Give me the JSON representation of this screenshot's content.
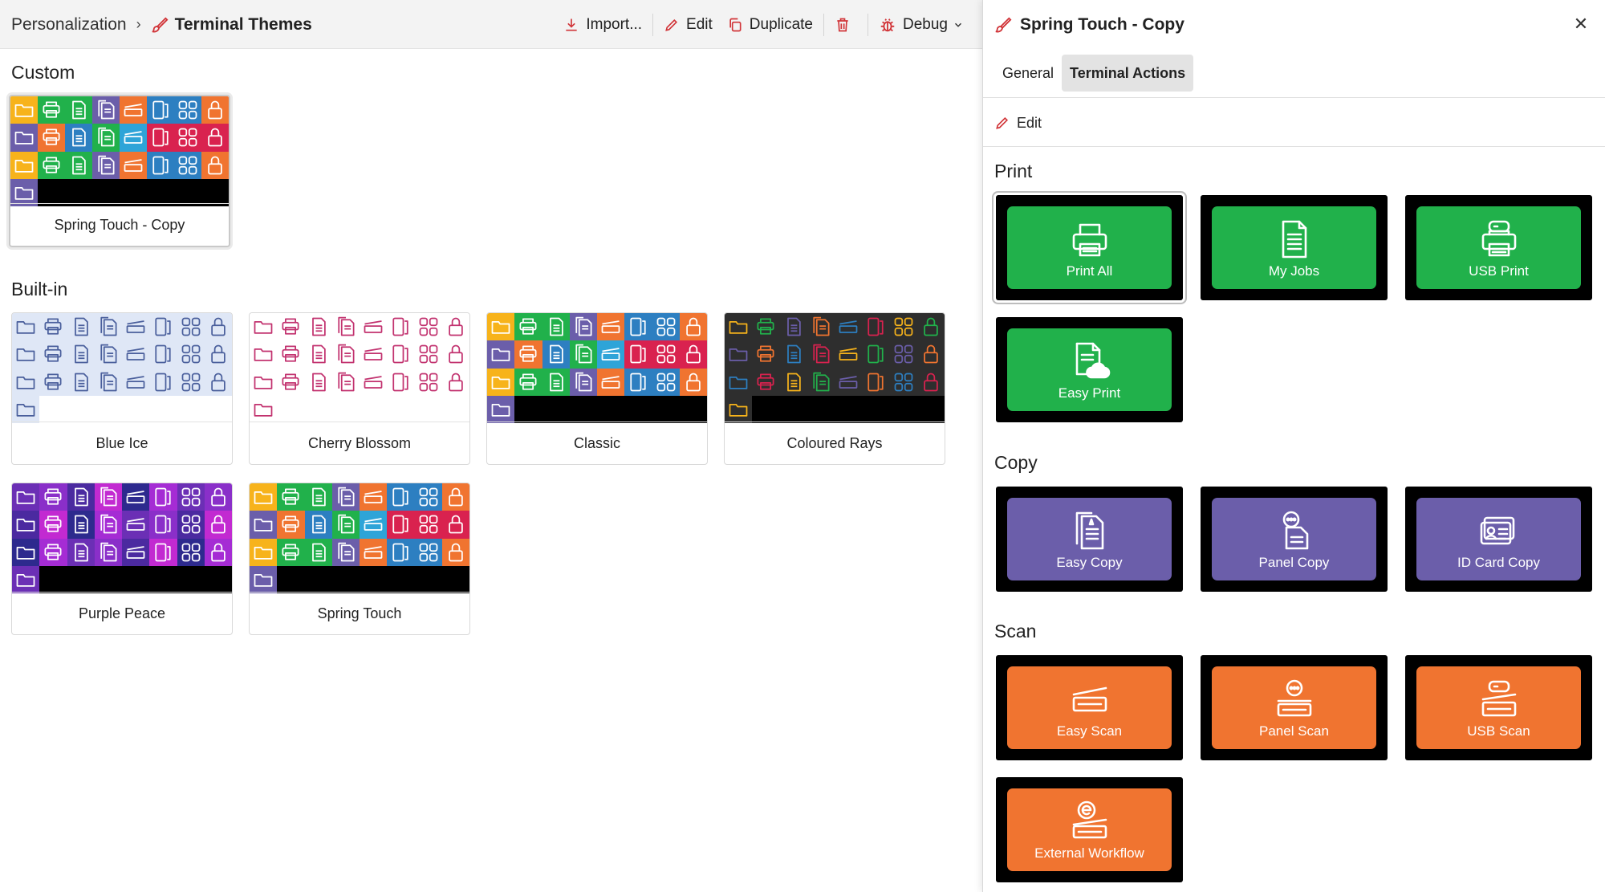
{
  "breadcrumb": {
    "parent": "Personalization",
    "current": "Terminal Themes"
  },
  "toolbar": {
    "import": "Import...",
    "edit": "Edit",
    "duplicate": "Duplicate",
    "debug": "Debug"
  },
  "sections": {
    "custom": "Custom",
    "builtin": "Built-in"
  },
  "themes": {
    "custom": [
      {
        "name": "Spring Touch - Copy"
      }
    ],
    "builtin": [
      {
        "name": "Blue Ice"
      },
      {
        "name": "Cherry Blossom"
      },
      {
        "name": "Classic"
      },
      {
        "name": "Coloured Rays"
      },
      {
        "name": "Purple Peace"
      },
      {
        "name": "Spring Touch"
      }
    ]
  },
  "panel": {
    "title": "Spring Touch - Copy",
    "tabs": [
      "General",
      "Terminal Actions"
    ],
    "edit": "Edit",
    "groups": {
      "print": {
        "title": "Print",
        "color": "#21b14b",
        "items": [
          {
            "label": "Print All",
            "icon": "printer-icon"
          },
          {
            "label": "My Jobs",
            "icon": "document-icon"
          },
          {
            "label": "USB Print",
            "icon": "usb-printer-icon"
          },
          {
            "label": "Easy Print",
            "icon": "cloud-document-icon"
          }
        ]
      },
      "copy": {
        "title": "Copy",
        "color": "#6b5eaa",
        "items": [
          {
            "label": "Easy Copy",
            "icon": "copy-document-icon"
          },
          {
            "label": "Panel Copy",
            "icon": "panel-copy-icon"
          },
          {
            "label": "ID Card Copy",
            "icon": "id-card-icon"
          }
        ]
      },
      "scan": {
        "title": "Scan",
        "color": "#f07430",
        "items": [
          {
            "label": "Easy Scan",
            "icon": "scanner-icon"
          },
          {
            "label": "Panel Scan",
            "icon": "panel-scan-icon"
          },
          {
            "label": "USB Scan",
            "icon": "usb-scan-icon"
          },
          {
            "label": "External Workflow",
            "icon": "workflow-icon"
          }
        ]
      }
    }
  },
  "colors": {
    "accent_red": "#d13438",
    "print_green": "#21b14b",
    "copy_purple": "#6b5eaa",
    "scan_orange": "#f07430",
    "classic_palette": [
      "#f7b31b",
      "#21b14b",
      "#21b14b",
      "#6b5eaa",
      "#f07430",
      "#2d7fc1",
      "#2d7fc1",
      "#f07430",
      "#6b5eaa",
      "#f07430",
      "#2d7fc1",
      "#21b14b",
      "#2ea4d8",
      "#d9224f",
      "#d9224f",
      "#d9224f"
    ],
    "blue_ice_palette": [
      "#dfe7f6",
      "#4a5f9c"
    ],
    "cherry_palette": [
      "#ffffff",
      "#c2326f"
    ],
    "rays_palette": [
      "#2e2e2e",
      "#f7b31b",
      "#21b14b",
      "#6b5eaa",
      "#f07430",
      "#2d7fc1",
      "#d9224f"
    ],
    "purple_palette": [
      "#6b2fb5",
      "#8a2fc9",
      "#4b2aa0",
      "#c22ad1",
      "#2d2a8e",
      "#a52cd4"
    ]
  }
}
